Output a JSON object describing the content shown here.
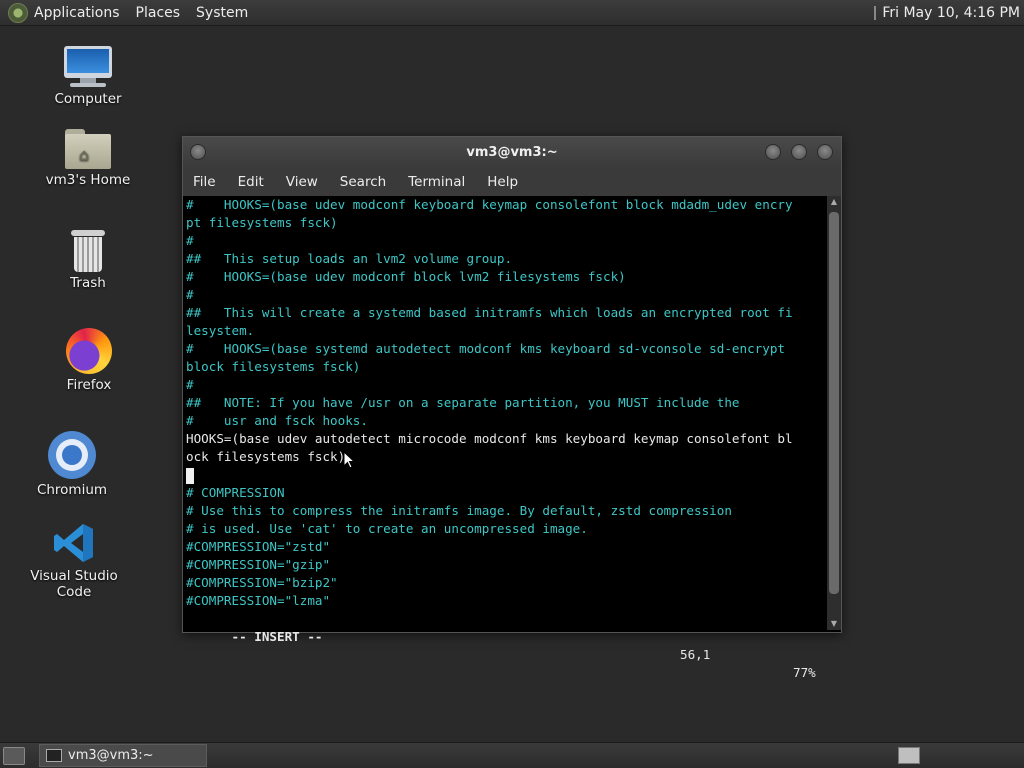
{
  "top_panel": {
    "menus": [
      "Applications",
      "Places",
      "System"
    ],
    "clock": "Fri May 10,  4:16 PM"
  },
  "desktop_icons": [
    {
      "label": "Computer",
      "icon": "computer-icon"
    },
    {
      "label": "vm3's Home",
      "icon": "home-folder-icon"
    },
    {
      "label": "Trash",
      "icon": "trash-icon"
    },
    {
      "label": "Firefox",
      "icon": "firefox-icon"
    },
    {
      "label": "Chromium",
      "icon": "chromium-icon"
    },
    {
      "label": "Visual Studio Code",
      "icon": "vscode-icon"
    }
  ],
  "terminal": {
    "title": "vm3@vm3:~",
    "menu": [
      "File",
      "Edit",
      "View",
      "Search",
      "Terminal",
      "Help"
    ],
    "lines": [
      "#    HOOKS=(base udev modconf keyboard keymap consolefont block mdadm_udev encry",
      "pt filesystems fsck)",
      "#",
      "##   This setup loads an lvm2 volume group.",
      "#    HOOKS=(base udev modconf block lvm2 filesystems fsck)",
      "#",
      "##   This will create a systemd based initramfs which loads an encrypted root fi",
      "lesystem.",
      "#    HOOKS=(base systemd autodetect modconf kms keyboard sd-vconsole sd-encrypt",
      "block filesystems fsck)",
      "#",
      "##   NOTE: If you have /usr on a separate partition, you MUST include the",
      "#    usr and fsck hooks.",
      "HOOKS=(base udev autodetect microcode modconf kms keyboard keymap consolefont bl",
      "ock filesystems fsck)",
      "",
      "# COMPRESSION",
      "# Use this to compress the initramfs image. By default, zstd compression",
      "# is used. Use 'cat' to create an uncompressed image.",
      "#COMPRESSION=\"zstd\"",
      "#COMPRESSION=\"gzip\"",
      "#COMPRESSION=\"bzip2\"",
      "#COMPRESSION=\"lzma\""
    ],
    "status": {
      "mode": "-- INSERT --",
      "position": "56,1",
      "percent": "77%"
    }
  },
  "taskbar": {
    "tasks": [
      {
        "label": "vm3@vm3:~"
      }
    ]
  }
}
